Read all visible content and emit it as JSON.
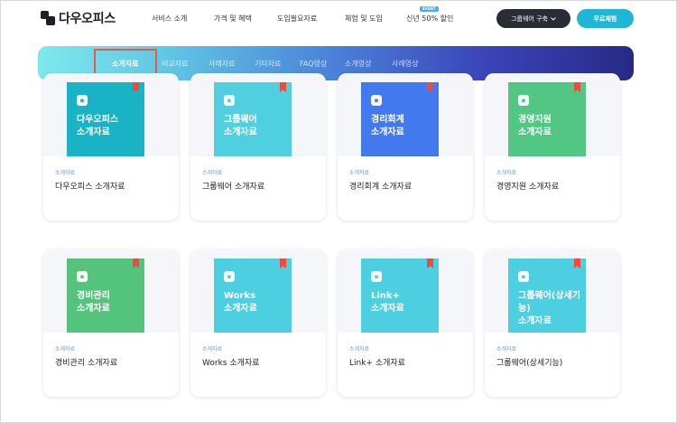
{
  "brand": {
    "name": "다우오피스"
  },
  "nav": {
    "items": [
      "서비스 소개",
      "가격 및 혜택",
      "도입필요자료",
      "체험 및 도입",
      "신년 50% 할인"
    ],
    "event_badge": "EVENT"
  },
  "header_buttons": {
    "groupware": "그룹웨어 구축",
    "free_trial": "무료체험"
  },
  "tabs": [
    "소개자료",
    "비교자료",
    "사례자료",
    "기타자료",
    "FAQ영상",
    "소개영상",
    "사례영상"
  ],
  "active_tab": "소개자료",
  "cards": [
    {
      "book_title": "다우오피스\n소개자료",
      "category": "소개자료",
      "name": "다우오피스 소개자료",
      "color": "#1ab3c5"
    },
    {
      "book_title": "그룹웨어\n소개자료",
      "category": "소개자료",
      "name": "그룹웨어 소개자료",
      "color": "#4fcfe0"
    },
    {
      "book_title": "경리회계\n소개자료",
      "category": "소개자료",
      "name": "경리회계 소개자료",
      "color": "#4379ef"
    },
    {
      "book_title": "경영지원\n소개자료",
      "category": "소개자료",
      "name": "경영지원 소개자료",
      "color": "#52c784"
    },
    {
      "book_title": "경비관리\n소개자료",
      "category": "소개자료",
      "name": "경비관리 소개자료",
      "color": "#54c47d"
    },
    {
      "book_title": "Works\n소개자료",
      "category": "소개자료",
      "name": "Works 소개자료",
      "color": "#4ccfe0"
    },
    {
      "book_title": "Link+\n소개자료",
      "category": "소개자료",
      "name": "Link+ 소개자료",
      "color": "#4ccfe0"
    },
    {
      "book_title": "그룹웨어(상세기능)\n소개자료",
      "category": "소개자료",
      "name": "그룹웨어(상세기능)",
      "color": "#4ccfe0"
    }
  ],
  "colors": {
    "accent": "#1fb5d6",
    "dark_button": "#2a2d35",
    "highlight_box": "#e05a4e",
    "ribbon": "#ee4b40"
  }
}
